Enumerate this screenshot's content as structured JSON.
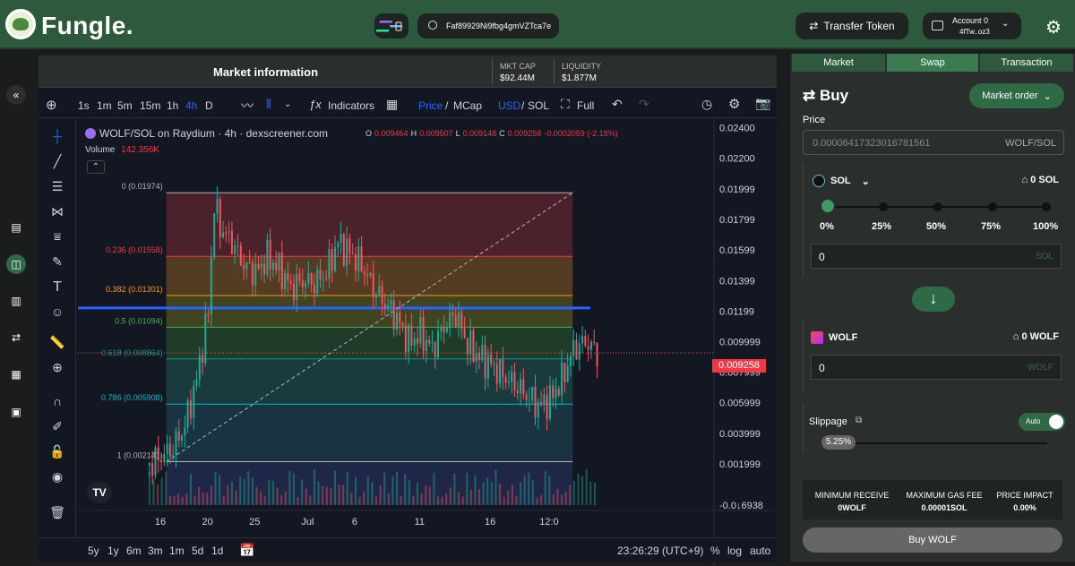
{
  "header": {
    "brand": "Fungle.",
    "address": "Faf89929Ni9fbg4gmVZTca7e",
    "transfer_label": "Transfer Token",
    "account_title": "Account 0",
    "account_sub": "4fTw..oz3"
  },
  "market": {
    "title": "Market information",
    "mkt_cap_label": "MKT CAP",
    "mkt_cap_value": "$92.44M",
    "liquidity_label": "LIQUIDITY",
    "liquidity_value": "$1.877M"
  },
  "toolbar": {
    "intervals": [
      "1s",
      "1m",
      "5m",
      "15m",
      "1h",
      "4h",
      "D"
    ],
    "active_interval": "4h",
    "indicators": "Indicators",
    "price": "Price",
    "mcap": "MCap",
    "usd": "USD",
    "sol": "SOL",
    "full": "Full"
  },
  "chart": {
    "symbol": "WOLF/SOL on Raydium · 4h · dexscreener.com",
    "ohlc_o_label": "O",
    "ohlc_o": "0.009464",
    "ohlc_h_label": "H",
    "ohlc_h": "0.009507",
    "ohlc_l_label": "L",
    "ohlc_l": "0.009148",
    "ohlc_c_label": "C",
    "ohlc_c": "0.009258",
    "ohlc_change": "-0.0002059 (-2.18%)",
    "volume_label": "Volume",
    "volume_value": "142.356K",
    "last_price": "0.009258",
    "time_display": "23:26:29 (UTC+9)",
    "ranges": [
      "5y",
      "1y",
      "6m",
      "3m",
      "1m",
      "5d",
      "1d"
    ],
    "pct": "%",
    "log": "log",
    "auto": "auto"
  },
  "chart_data": {
    "type": "candlestick",
    "title": "WOLF/SOL on Raydium · 4h · dexscreener.com",
    "y_ticks": [
      "0.02400",
      "0.02200",
      "0.01999",
      "0.01799",
      "0.01599",
      "0.01399",
      "0.01199",
      "0.009999",
      "0.007999",
      "0.005999",
      "0.003999",
      "0.001999",
      "-0.0↓6938"
    ],
    "x_ticks": [
      "16",
      "20",
      "25",
      "Jul",
      "6",
      "11",
      "16",
      "12:0"
    ],
    "ylim": [
      -0.0007,
      0.0245
    ],
    "fib_levels": [
      {
        "label": "0 (0.01974)",
        "value": 0.01974,
        "color": "#b2b5be"
      },
      {
        "label": "0.236 (0.01558)",
        "value": 0.01558,
        "color": "#f23645"
      },
      {
        "label": "0.382 (0.01301)",
        "value": 0.01301,
        "color": "#ff9800"
      },
      {
        "label": "0.5 (0.01094)",
        "value": 0.01094,
        "color": "#4caf50"
      },
      {
        "label": "0.618 (0.008864)",
        "value": 0.008864,
        "color": "#089981"
      },
      {
        "label": "0.786 (0.005908)",
        "value": 0.005908,
        "color": "#00bcd4"
      },
      {
        "label": "1 (0.002141)",
        "value": 0.002141,
        "color": "#b2b5be"
      }
    ],
    "fib_zones": [
      "#7a2a35",
      "#8a5a25",
      "#6a6a20",
      "#2a5a30",
      "#1f5a55",
      "#1f4d5a",
      "#3a3d48"
    ],
    "horizontal_line": 0.0122,
    "price_path": [
      {
        "x": 16,
        "y": 0.0019
      },
      {
        "x": 17,
        "y": 0.0025
      },
      {
        "x": 18,
        "y": 0.003
      },
      {
        "x": 19,
        "y": 0.0045
      },
      {
        "x": 20,
        "y": 0.0075
      },
      {
        "x": 21,
        "y": 0.012
      },
      {
        "x": 21.5,
        "y": 0.019
      },
      {
        "x": 22,
        "y": 0.0175
      },
      {
        "x": 23,
        "y": 0.0165
      },
      {
        "x": 24,
        "y": 0.015
      },
      {
        "x": 25,
        "y": 0.0145
      },
      {
        "x": 26,
        "y": 0.0155
      },
      {
        "x": 27,
        "y": 0.0148
      },
      {
        "x": 28,
        "y": 0.0135
      },
      {
        "x": 29,
        "y": 0.014
      },
      {
        "x": 30,
        "y": 0.0138
      },
      {
        "x": 31,
        "y": 0.0145
      },
      {
        "x": 32,
        "y": 0.0165
      },
      {
        "x": 33,
        "y": 0.0158
      },
      {
        "x": 34,
        "y": 0.015
      },
      {
        "x": 35,
        "y": 0.0135
      },
      {
        "x": 36,
        "y": 0.0125
      },
      {
        "x": 37,
        "y": 0.0115
      },
      {
        "x": 38,
        "y": 0.01
      },
      {
        "x": 39,
        "y": 0.0105
      },
      {
        "x": 40,
        "y": 0.0095
      },
      {
        "x": 41,
        "y": 0.011
      },
      {
        "x": 42,
        "y": 0.0118
      },
      {
        "x": 43,
        "y": 0.0098
      },
      {
        "x": 44,
        "y": 0.009
      },
      {
        "x": 45,
        "y": 0.0085
      },
      {
        "x": 46,
        "y": 0.0078
      },
      {
        "x": 47,
        "y": 0.0072
      },
      {
        "x": 48,
        "y": 0.0065
      },
      {
        "x": 49,
        "y": 0.0058
      },
      {
        "x": 50,
        "y": 0.0062
      },
      {
        "x": 51,
        "y": 0.0075
      },
      {
        "x": 52,
        "y": 0.0095
      },
      {
        "x": 53,
        "y": 0.01
      },
      {
        "x": 54,
        "y": 0.0093
      }
    ]
  },
  "trade": {
    "tabs": [
      "Market",
      "Swap",
      "Transaction"
    ],
    "active_tab": "Swap",
    "buy_title": "Buy",
    "order_type": "Market order",
    "price_label": "Price",
    "price_value": "0.00006417323016781561",
    "price_unit": "WOLF/SOL",
    "sol_token": "SOL",
    "sol_balance": "0 SOL",
    "pct_marks": [
      "0%",
      "25%",
      "50%",
      "75%",
      "100%"
    ],
    "sol_amount": "0",
    "sol_unit": "SOL",
    "wolf_token": "WOLF",
    "wolf_balance": "0 WOLF",
    "wolf_amount": "0",
    "wolf_unit": "WOLF",
    "slippage_label": "Slippage",
    "auto_label": "Auto",
    "slippage_value": "5.25%",
    "min_receive_label": "MINIMUM RECEIVE",
    "min_receive_value": "0WOLF",
    "gas_label": "MAXIMUM GAS FEE",
    "gas_value": "0.00001SOL",
    "impact_label": "PRICE IMPACT",
    "impact_value": "0.00%",
    "buy_button": "Buy WOLF"
  }
}
